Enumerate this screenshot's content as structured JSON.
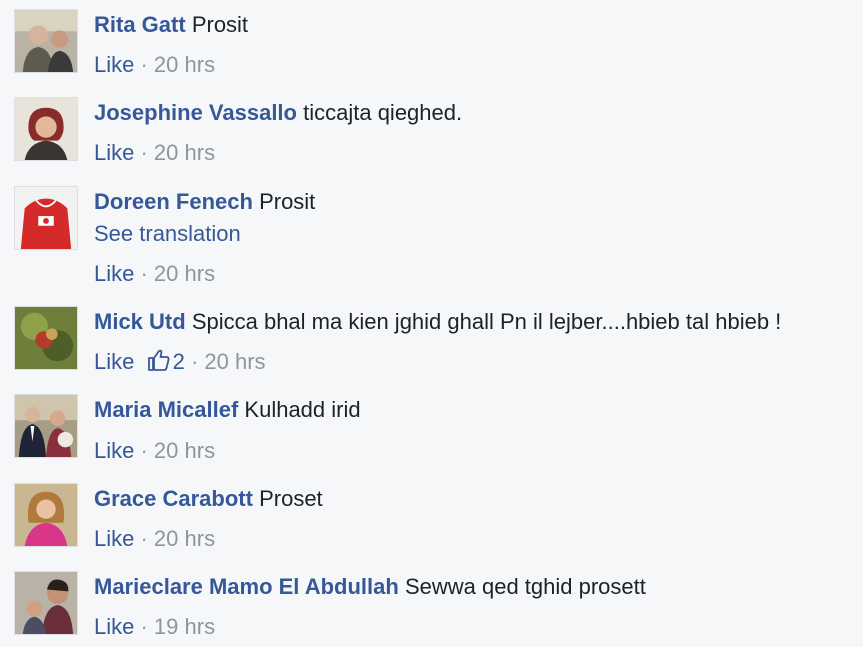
{
  "comments": [
    {
      "author": "Rita Gatt",
      "text": "Prosit",
      "like": "Like",
      "sep": " · ",
      "time": "20 hrs"
    },
    {
      "author": "Josephine Vassallo",
      "text": "ticcajta qieghed.",
      "like": "Like",
      "sep": " · ",
      "time": "20 hrs"
    },
    {
      "author": "Doreen Fenech",
      "text": "Prosit",
      "translation": "See translation",
      "like": "Like",
      "sep": " · ",
      "time": "20 hrs"
    },
    {
      "author": "Mick Utd",
      "text": "Spicca bhal ma kien jghid ghall Pn il lejber....hbieb tal hbieb !",
      "like": "Like",
      "reaction_count": "2",
      "sep": " · ",
      "time": "20 hrs"
    },
    {
      "author": "Maria Micallef",
      "text": "Kulhadd irid",
      "like": "Like",
      "sep": " · ",
      "time": "20 hrs"
    },
    {
      "author": "Grace Carabott",
      "text": "Proset",
      "like": "Like",
      "sep": " · ",
      "time": "20 hrs"
    },
    {
      "author": "Marieclare Mamo El Abdullah",
      "text": "Sewwa qed tghid prosett",
      "like": "Like",
      "sep": " · ",
      "time": "19 hrs"
    }
  ],
  "colors": {
    "background": "#f6f7f9",
    "author_link": "#365899",
    "body_text": "#1d2129",
    "meta_text": "#90949c"
  },
  "icons": {
    "reaction": "thumbs-up-icon"
  }
}
